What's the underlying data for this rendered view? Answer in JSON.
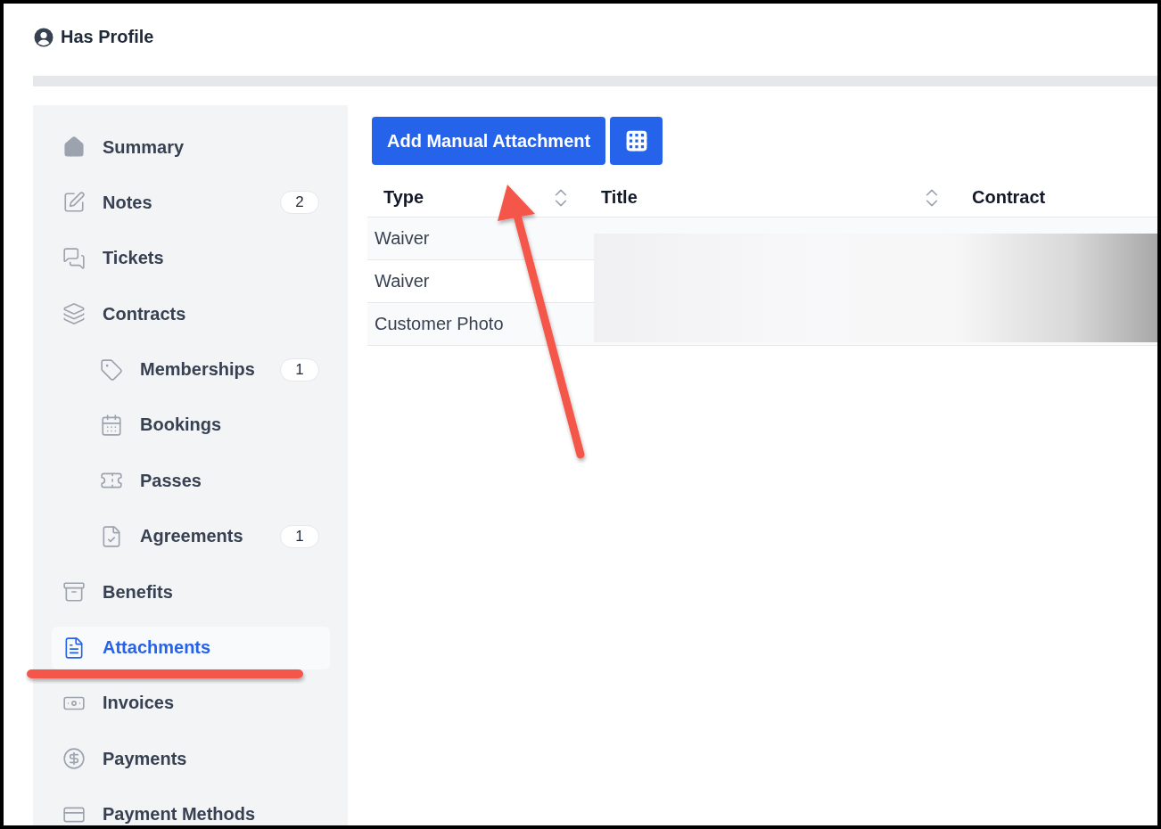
{
  "profile": {
    "title": "Has Profile"
  },
  "sidebar": {
    "items": [
      {
        "label": "Summary",
        "selected": false
      },
      {
        "label": "Notes",
        "badge": "2",
        "selected": false
      },
      {
        "label": "Tickets",
        "selected": false
      },
      {
        "label": "Contracts",
        "selected": false,
        "children": [
          {
            "label": "Memberships",
            "badge": "1",
            "selected": false
          },
          {
            "label": "Bookings",
            "selected": false
          },
          {
            "label": "Passes",
            "selected": false
          },
          {
            "label": "Agreements",
            "badge": "1",
            "selected": false
          }
        ]
      },
      {
        "label": "Benefits",
        "selected": false
      },
      {
        "label": "Attachments",
        "selected": true
      },
      {
        "label": "Invoices",
        "selected": false
      },
      {
        "label": "Payments",
        "selected": false
      },
      {
        "label": "Payment Methods",
        "selected": false
      }
    ]
  },
  "toolbar": {
    "primary_button": "Add Manual Attachment"
  },
  "table": {
    "redacted": true,
    "columns": [
      {
        "label": "Type",
        "sortable": true
      },
      {
        "label": "Title",
        "sortable": true
      },
      {
        "label": "Contract",
        "sortable": false
      }
    ],
    "rows": [
      {
        "type": "Waiver"
      },
      {
        "type": "Waiver"
      },
      {
        "type": "Customer Photo"
      }
    ]
  },
  "annotations": {
    "arrow": true,
    "underline": true
  }
}
